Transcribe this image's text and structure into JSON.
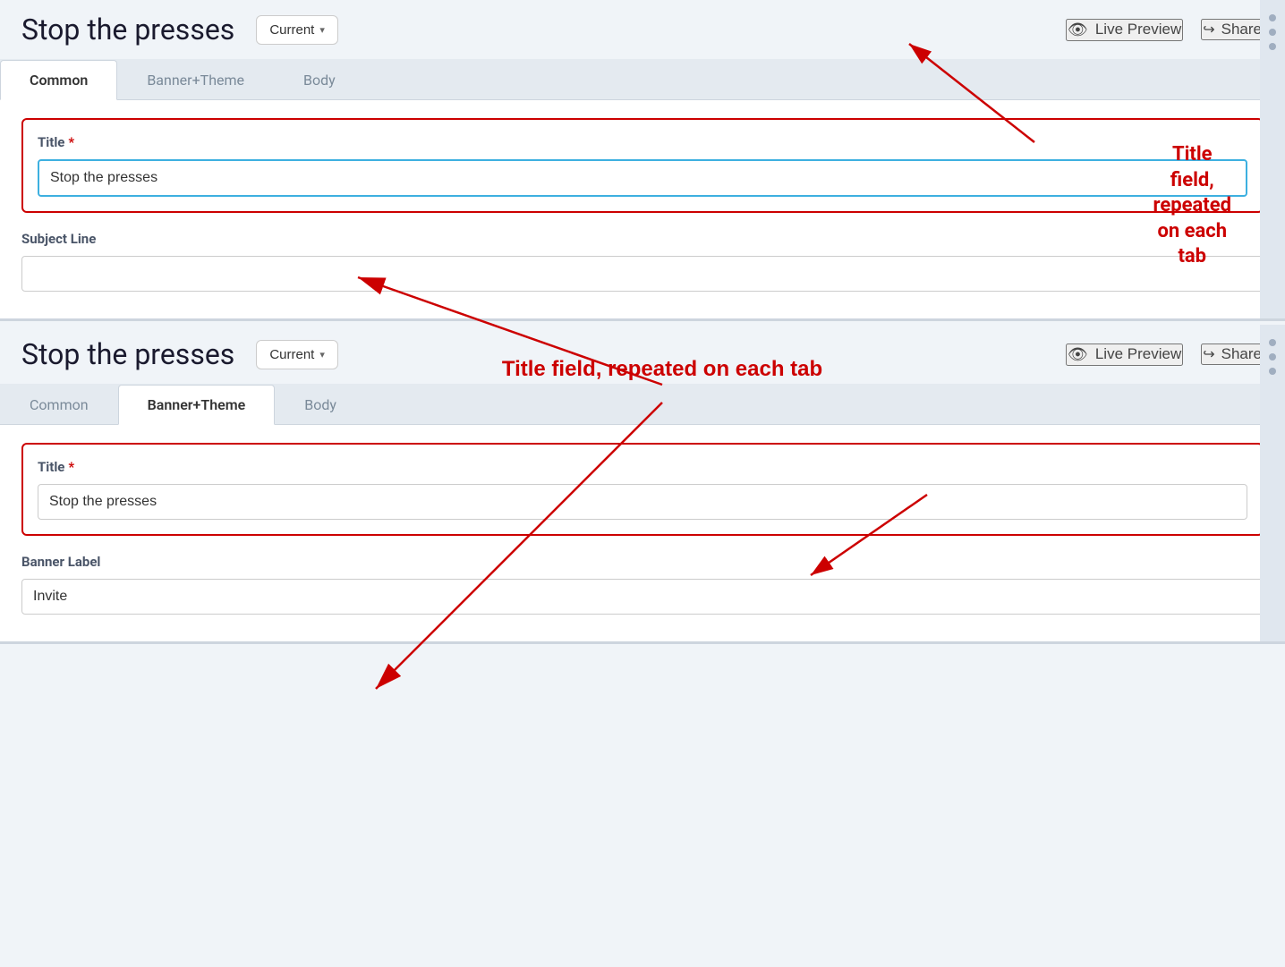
{
  "section1": {
    "title": "Stop the presses",
    "current_btn": "Current",
    "chevron": "▾",
    "live_preview_label": "Live Preview",
    "share_label": "Share",
    "tabs": [
      {
        "id": "common",
        "label": "Common",
        "active": true
      },
      {
        "id": "banner-theme",
        "label": "Banner+Theme",
        "active": false
      },
      {
        "id": "body",
        "label": "Body",
        "active": false
      }
    ],
    "title_field_label": "Title",
    "required_star": "*",
    "title_field_value": "Stop the presses",
    "subject_line_label": "Subject Line",
    "subject_line_placeholder": ""
  },
  "section2": {
    "title": "Stop the presses",
    "current_btn": "Current",
    "chevron": "▾",
    "live_preview_label": "Live Preview",
    "share_label": "Share",
    "tabs": [
      {
        "id": "common",
        "label": "Common",
        "active": false
      },
      {
        "id": "banner-theme",
        "label": "Banner+Theme",
        "active": true
      },
      {
        "id": "body",
        "label": "Body",
        "active": false
      }
    ],
    "title_field_label": "Title",
    "required_star": "*",
    "title_field_value": "Stop the presses",
    "banner_label_label": "Banner Label",
    "banner_label_value": "Invite"
  },
  "annotation": {
    "text": "Title field, repeated on each tab"
  }
}
